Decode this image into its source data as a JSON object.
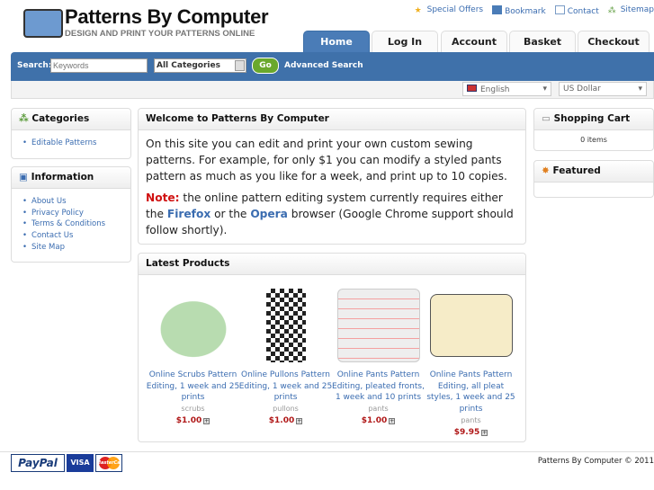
{
  "header": {
    "title": "Patterns By Computer",
    "tagline": "DESIGN AND PRINT YOUR PATTERNS ONLINE",
    "toplinks": [
      {
        "label": "Special Offers",
        "icon": "star-icon"
      },
      {
        "label": "Bookmark",
        "icon": "bookmark-icon"
      },
      {
        "label": "Contact",
        "icon": "envelope-icon"
      },
      {
        "label": "Sitemap",
        "icon": "sitemap-icon"
      }
    ],
    "tabs": [
      "Home",
      "Log In",
      "Account",
      "Basket",
      "Checkout"
    ]
  },
  "search": {
    "label": "Search:",
    "placeholder": "Keywords",
    "category": "All Categories",
    "go": "Go",
    "advanced": "Advanced Search"
  },
  "language": "English",
  "currency": "US Dollar",
  "left": {
    "categories_title": "Categories",
    "categories": [
      "Editable Patterns"
    ],
    "info_title": "Information",
    "info": [
      "About Us",
      "Privacy Policy",
      "Terms & Conditions",
      "Contact Us",
      "Site Map"
    ]
  },
  "welcome": {
    "title": "Welcome to Patterns By Computer",
    "p1": "On this site you can edit and print your own custom sewing patterns. For example, for only $1 you can modify a styled pants pattern as much as you like for a week, and print up to 10 copies.",
    "note_label": "Note:",
    "note_a": " the online pattern editing system currently requires either the ",
    "firefox": "Firefox",
    "or": " or the ",
    "opera": "Opera",
    "note_b": " browser (Google Chrome support should follow shortly)."
  },
  "latest": {
    "title": "Latest Products",
    "products": [
      {
        "name": "Online Scrubs Pattern Editing, 1 week and 25 prints",
        "category": "scrubs",
        "price": "$1.00"
      },
      {
        "name": "Online Pullons Pattern Editing, 1 week and 25 prints",
        "category": "pullons",
        "price": "$1.00"
      },
      {
        "name": "Online Pants Pattern Editing, pleated fronts, 1 week and 10 prints",
        "category": "pants",
        "price": "$1.00"
      },
      {
        "name": "Online Pants Pattern Editing, all pleat styles, 1 week and 25 prints",
        "category": "pants",
        "price": "$9.95"
      }
    ]
  },
  "right": {
    "cart_title": "Shopping Cart",
    "cart_items": "0 items",
    "featured_title": "Featured"
  },
  "footer": {
    "copyright": "Patterns By Computer © 2011",
    "payments": [
      "PayPal",
      "VISA",
      "MasterCard"
    ]
  }
}
